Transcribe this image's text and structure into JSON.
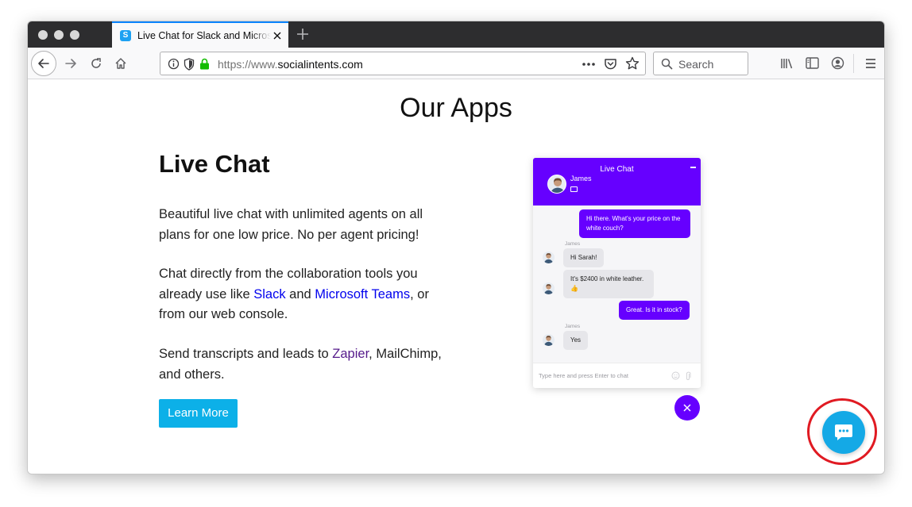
{
  "browser": {
    "tab_title": "Live Chat for Slack and Microsoft Teams",
    "favicon_letter": "S",
    "url_protocol": "https://www.",
    "url_host": "socialintents.com",
    "search_placeholder": "Search",
    "icons": [
      "back-icon",
      "forward-icon",
      "reload-icon",
      "home-icon",
      "info-icon",
      "tracking-shield-icon",
      "lock-icon",
      "page-actions-icon",
      "pocket-icon",
      "bookmark-star-icon",
      "search-icon",
      "library-icon",
      "sidebar-icon",
      "account-icon",
      "menu-icon"
    ]
  },
  "page": {
    "heading": "Our Apps",
    "section_title": "Live Chat",
    "para1": "Beautiful live chat with unlimited agents on all plans for one low price. No per agent pricing!",
    "para2": {
      "before": "Chat directly from the collaboration tools you already use like ",
      "link1": "Slack",
      "between": " and ",
      "link2": "Microsoft Teams",
      "after": ", or from our web console."
    },
    "para3": {
      "before": "Send transcripts and leads to ",
      "link": "Zapier",
      "after": ", MailChimp, and others."
    },
    "learn_more": "Learn More"
  },
  "chat_widget": {
    "title": "Live Chat",
    "agent_name": "James",
    "messages": [
      {
        "from": "visitor",
        "text": "Hi there. What's your price on the white couch?"
      },
      {
        "from": "agent",
        "name": "James",
        "text": "Hi Sarah!"
      },
      {
        "from": "agent",
        "text": "It's $2400 in white leather. 👍"
      },
      {
        "from": "visitor",
        "text": "Great. Is it in stock?"
      },
      {
        "from": "agent",
        "name": "James",
        "text": "Yes"
      }
    ],
    "input_placeholder": "Type here and press Enter to chat"
  },
  "colors": {
    "widget_brand": "#6600ff",
    "button_blue": "#0cb0e8",
    "fab_blue": "#14a9e6",
    "link": "#0000ee",
    "visited_link": "#551a8b",
    "highlight": "#e01a22"
  }
}
